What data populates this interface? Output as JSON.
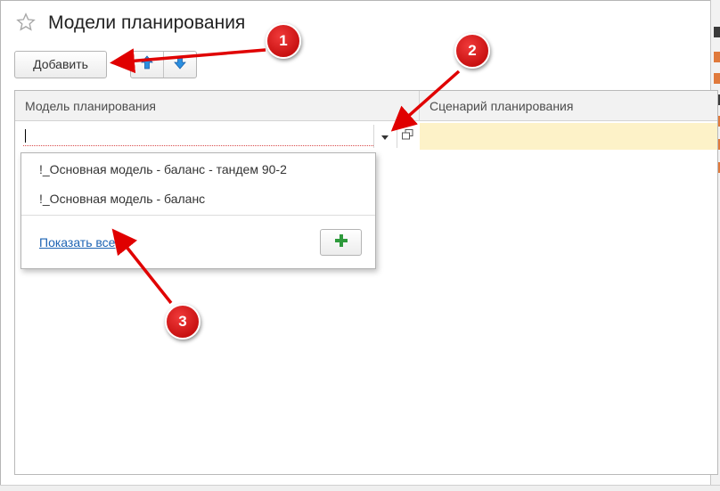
{
  "window": {
    "title": "Модели планирования"
  },
  "toolbar": {
    "add_label": "Добавить",
    "move_up_icon": "arrow-up-icon",
    "move_down_icon": "arrow-down-icon"
  },
  "grid": {
    "columns": [
      {
        "label": "Модель планирования"
      },
      {
        "label": "Сценарий планирования"
      }
    ],
    "edit_row": {
      "model_value": "",
      "scenario_value": ""
    }
  },
  "dropdown": {
    "items": [
      {
        "label": "!_Основная модель - баланс - тандем 90-2"
      },
      {
        "label": "!_Основная модель - баланс"
      }
    ],
    "show_all_label": "Показать все",
    "create_icon": "plus-icon"
  },
  "annotations": {
    "badges": [
      "1",
      "2",
      "3"
    ]
  },
  "colors": {
    "badge_red": "#d40000",
    "arrow_red": "#e00000",
    "plus_green": "#2e9a3c",
    "link_blue": "#1e64b4",
    "scenario_cell_bg": "#fdf2c8",
    "up_down_arrow_blue": "#2a8fe0"
  }
}
